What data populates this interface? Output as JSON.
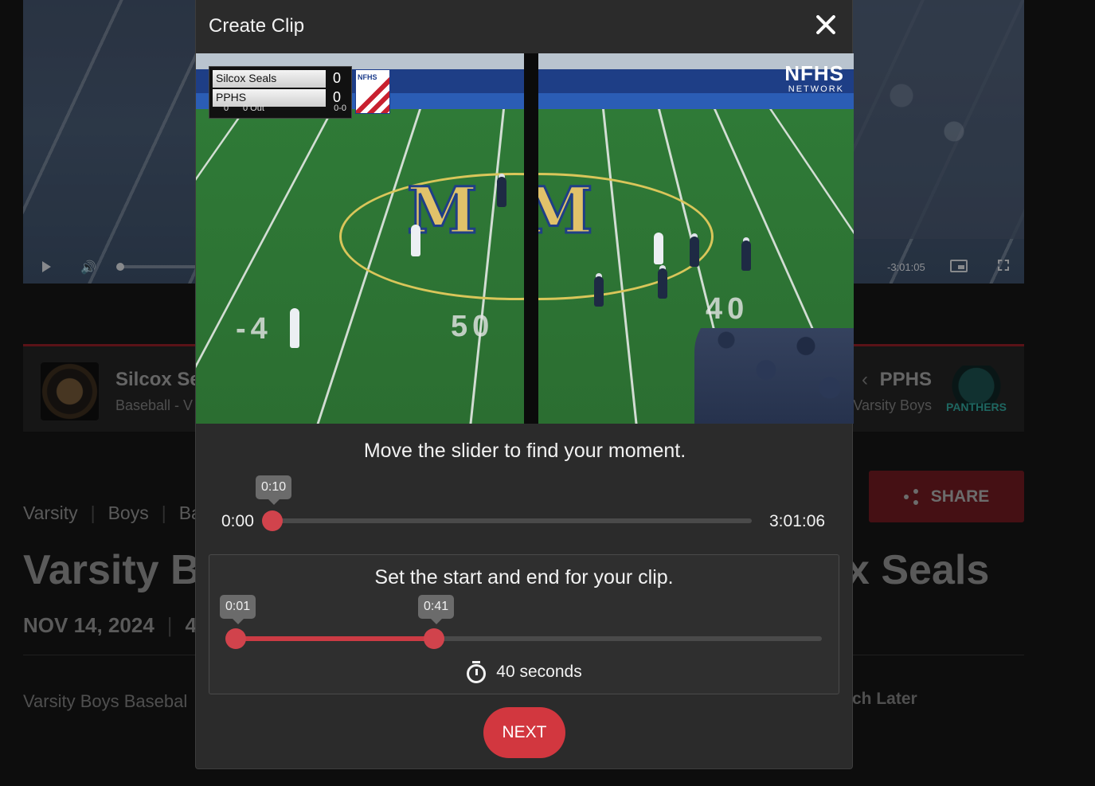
{
  "background": {
    "player": {
      "remaining_time": "-3:01:05"
    },
    "team_left": {
      "name": "Silcox Se",
      "sub": "Baseball - V"
    },
    "team_right": {
      "name": "PPHS",
      "sub": "Varsity Boys",
      "logo_text": "PANTHERS"
    },
    "share_label": "SHARE",
    "breadcrumbs": [
      "Varsity",
      "Boys",
      "Ba"
    ],
    "title_left": "Varsity B",
    "title_right": "x Seals",
    "date": "NOV 14, 2024",
    "date_extra": "4",
    "description": "Varsity Boys Basebal",
    "watch_later": "tch Later"
  },
  "modal": {
    "title": "Create Clip",
    "preview": {
      "scorebug": {
        "home": {
          "name": "Silcox Seals",
          "score": "0"
        },
        "away": {
          "name": "PPHS",
          "score": "0"
        },
        "inning": "0",
        "outs": "0 Out",
        "count": "0-0",
        "logo_text": "NFHS"
      },
      "watermark": {
        "big": "NFHS",
        "small": "NETWORK"
      },
      "yard_left": "-4",
      "yard_center": "50",
      "yard_right": "40"
    },
    "scrubber": {
      "prompt": "Move the slider to find your moment.",
      "start_label": "0:00",
      "end_label": "3:01:06",
      "current": "0:10",
      "position_fraction": 0.00092
    },
    "clip": {
      "prompt": "Set the start and end for your clip.",
      "start": "0:01",
      "end": "0:41",
      "duration": "40 seconds"
    },
    "next_label": "NEXT"
  },
  "colors": {
    "accent": "#d2373f",
    "modal_bg": "#2b2b2b"
  }
}
